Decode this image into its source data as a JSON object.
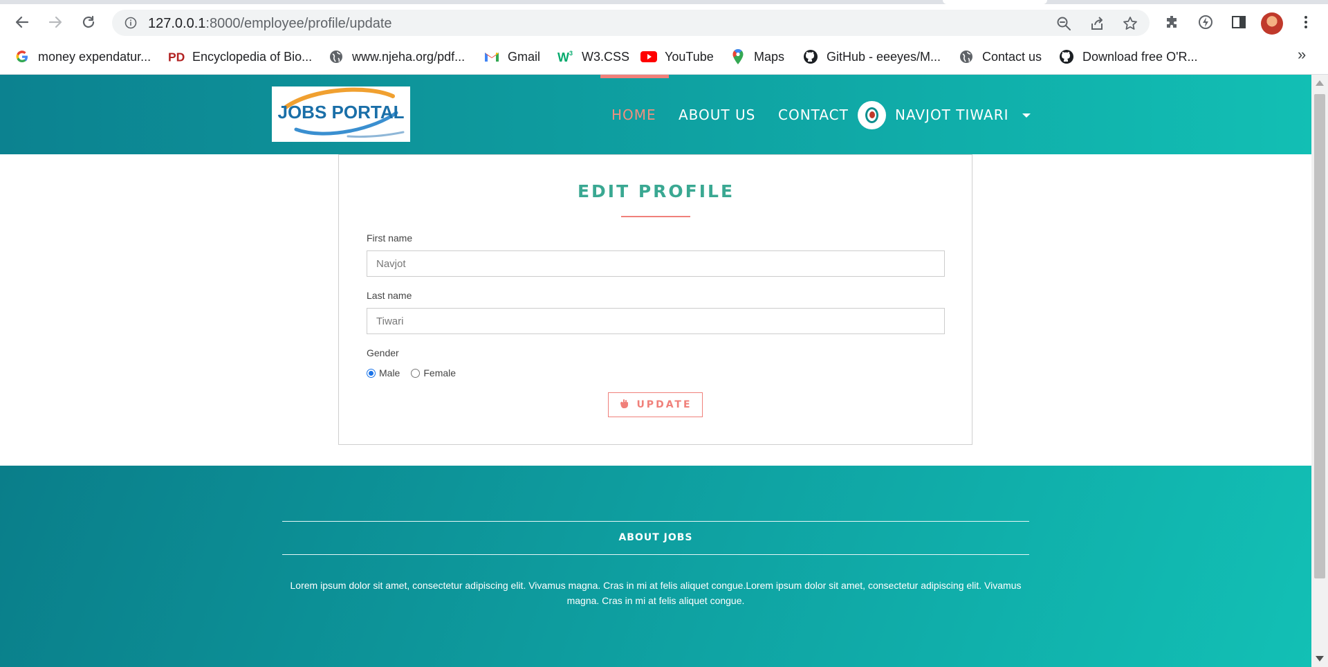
{
  "browser": {
    "url_host": "127.0.0.1",
    "url_path": ":8000/employee/profile/update",
    "bookmarks": [
      {
        "label": "money expendatur...",
        "icon": "google-icon"
      },
      {
        "label": "Encyclopedia of Bio...",
        "icon": "pd-icon"
      },
      {
        "label": "www.njeha.org/pdf...",
        "icon": "globe-icon"
      },
      {
        "label": "Gmail",
        "icon": "gmail-icon"
      },
      {
        "label": "W3.CSS",
        "icon": "w3-icon"
      },
      {
        "label": "YouTube",
        "icon": "youtube-icon"
      },
      {
        "label": "Maps",
        "icon": "maps-icon"
      },
      {
        "label": "GitHub - eeeyes/M...",
        "icon": "github-icon"
      },
      {
        "label": "Contact us",
        "icon": "globe-icon"
      },
      {
        "label": "Download free O'R...",
        "icon": "github-icon"
      }
    ],
    "more_label": "»"
  },
  "header": {
    "logo_text": "JOBS PORTAL",
    "nav": {
      "home": "HOME",
      "about": "ABOUT US",
      "contact": "CONTACT",
      "user": "NAVJOT TIWARI"
    }
  },
  "form": {
    "title": "EDIT PROFILE",
    "first_name_label": "First name",
    "first_name_value": "Navjot",
    "last_name_label": "Last name",
    "last_name_value": "Tiwari",
    "gender_label": "Gender",
    "gender_male": "Male",
    "gender_female": "Female",
    "gender_selected": "Male",
    "submit_label": "UPDATE"
  },
  "footer": {
    "title": "ABOUT JOBS",
    "text": "Lorem ipsum dolor sit amet, consectetur adipiscing elit. Vivamus magna. Cras in mi at felis aliquet congue.Lorem ipsum dolor sit amet, consectetur adipiscing elit. Vivamus magna. Cras in mi at felis aliquet congue."
  },
  "colors": {
    "brand_teal": "#0fa3a3",
    "accent_coral": "#f0807a",
    "title_green": "#3aa892"
  }
}
